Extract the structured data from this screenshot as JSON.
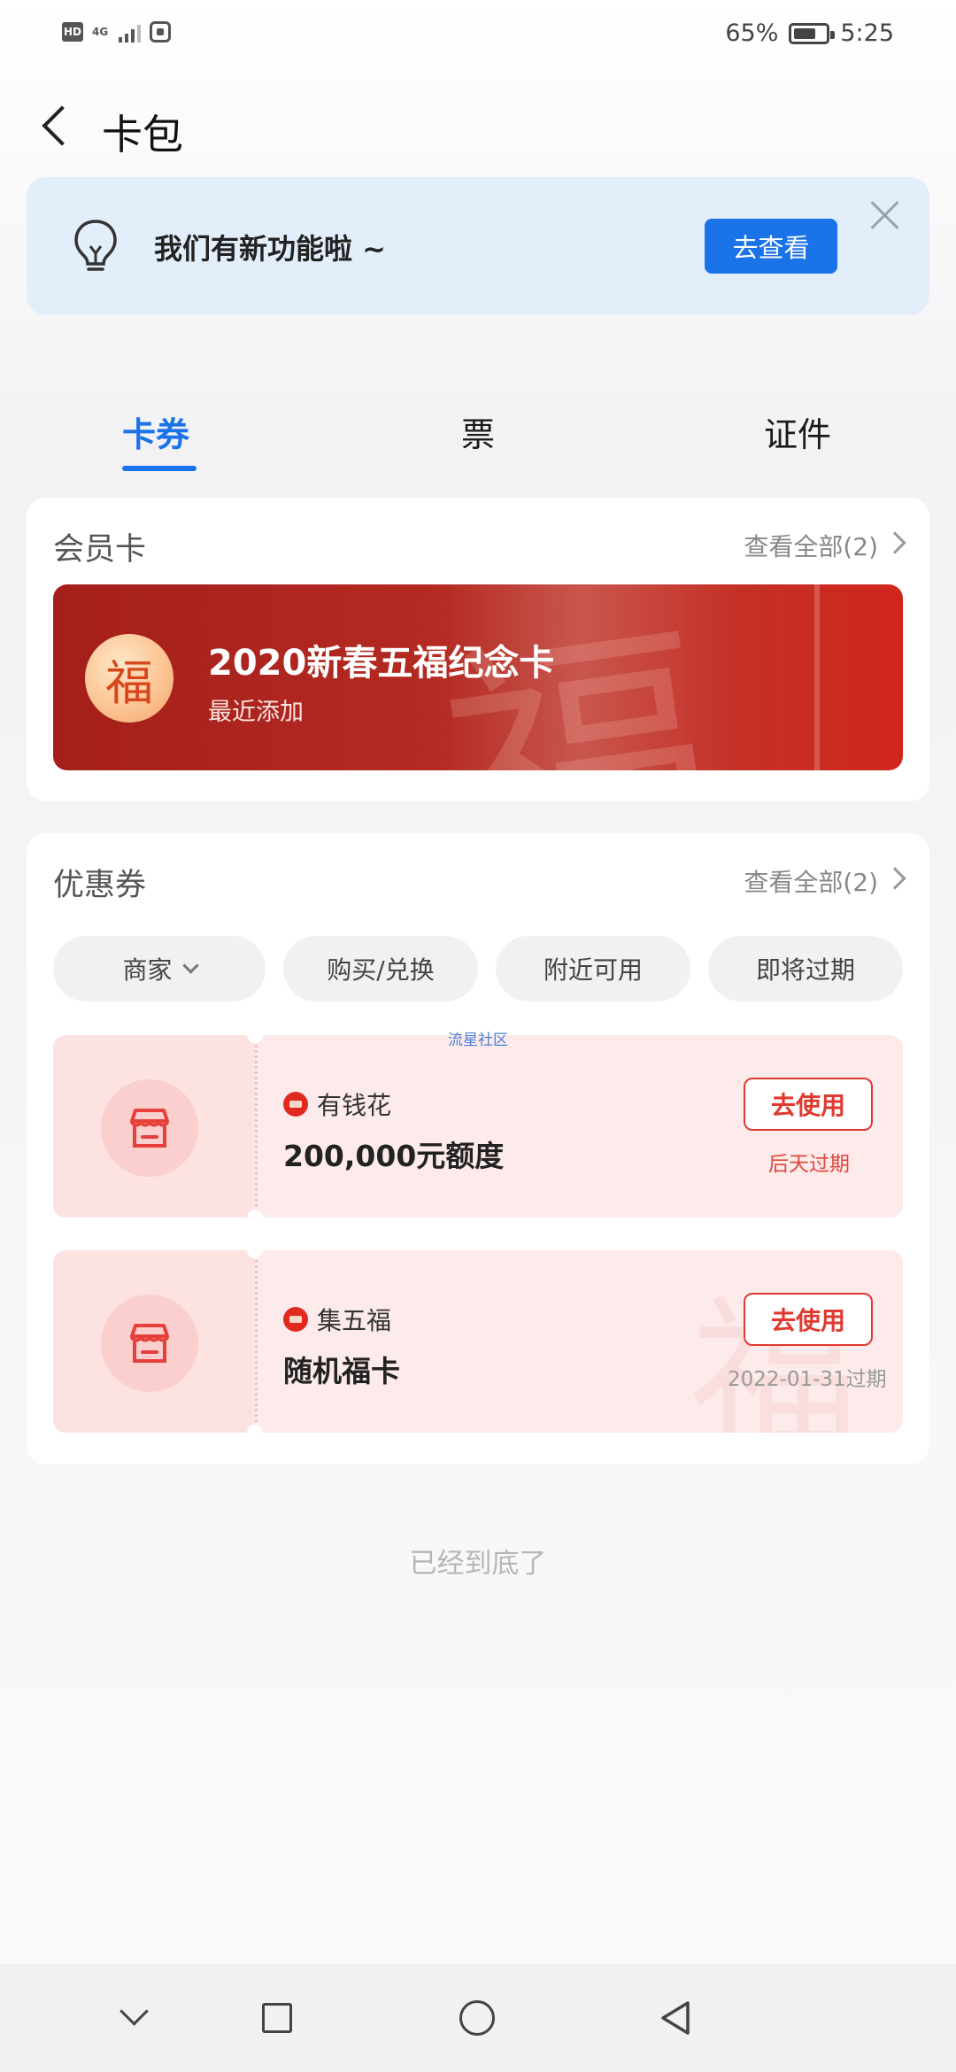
{
  "status_bar": {
    "battery_percent": "65%",
    "time": "5:25",
    "network": "4G",
    "hd_label": "HD"
  },
  "header": {
    "title": "卡包"
  },
  "banner": {
    "text": "我们有新功能啦 ~",
    "button_label": "去查看"
  },
  "tabs": [
    {
      "label": "卡券",
      "active": true
    },
    {
      "label": "票",
      "active": false
    },
    {
      "label": "证件",
      "active": false
    }
  ],
  "member_section": {
    "title": "会员卡",
    "view_all": "查看全部(2)",
    "card": {
      "title": "2020新春五福纪念卡",
      "subtitle": "最近添加",
      "logo_glyph": "福"
    }
  },
  "coupon_section": {
    "title": "优惠券",
    "view_all": "查看全部(2)",
    "filters": [
      "商家",
      "购买/兑换",
      "附近可用",
      "即将过期"
    ],
    "watermark": "流星社区",
    "coupons": [
      {
        "source": "有钱花",
        "title": "200,000元额度",
        "button": "去使用",
        "expiry": "后天过期"
      },
      {
        "source": "集五福",
        "title": "随机福卡",
        "button": "去使用",
        "expiry": "2022-01-31过期"
      }
    ]
  },
  "footer_tip": "已经到底了",
  "colors": {
    "accent": "#1a73e8",
    "red": "#e03a30",
    "card_red": "#b32a22"
  }
}
